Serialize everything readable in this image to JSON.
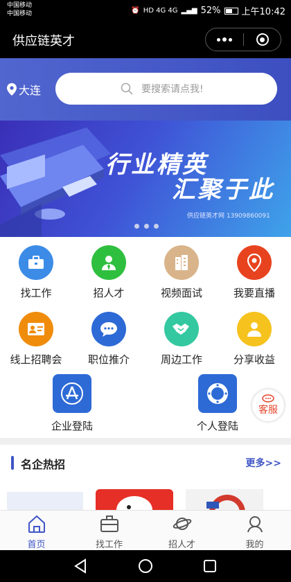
{
  "status_bar": {
    "carrier1": "中国移动",
    "carrier2": "中国移动",
    "network_badges": "HD 4G 4G",
    "battery": "52%",
    "time": "上午10:42"
  },
  "title_bar": {
    "title": "供应链英才"
  },
  "search": {
    "city": "大连",
    "placeholder": "要搜索请点我!"
  },
  "banner": {
    "line1": "行业精英",
    "line2": "汇聚于此",
    "caption": "供应链英才网 13909860091",
    "slides": 3
  },
  "grid": {
    "items": [
      {
        "label": "找工作",
        "icon": "briefcase-icon",
        "color": "#3c8ce7"
      },
      {
        "label": "招人才",
        "icon": "person-icon",
        "color": "#2fbf3f"
      },
      {
        "label": "视频面试",
        "icon": "building-icon",
        "color": "#d9b48a"
      },
      {
        "label": "我要直播",
        "icon": "location-pin-icon",
        "color": "#e8431f"
      },
      {
        "label": "线上招聘会",
        "icon": "id-card-icon",
        "color": "#f08c0c"
      },
      {
        "label": "职位推介",
        "icon": "chat-bubble-icon",
        "color": "#2d6ad6"
      },
      {
        "label": "周边工作",
        "icon": "handshake-icon",
        "color": "#34c8a0"
      },
      {
        "label": "分享收益",
        "icon": "person-icon",
        "color": "#f6c21d"
      }
    ],
    "logins": [
      {
        "label": "企业登陆",
        "icon": "app-store-icon"
      },
      {
        "label": "个人登陆",
        "icon": "ring-icon"
      }
    ],
    "service_label": "客服"
  },
  "companies": {
    "title": "名企热招",
    "more": "更多>>"
  },
  "tabbar": {
    "tabs": [
      {
        "label": "首页",
        "icon": "home-icon",
        "active": true
      },
      {
        "label": "找工作",
        "icon": "briefcase-icon",
        "active": false
      },
      {
        "label": "招人才",
        "icon": "planet-icon",
        "active": false
      },
      {
        "label": "我的",
        "icon": "user-icon",
        "active": false
      }
    ]
  }
}
